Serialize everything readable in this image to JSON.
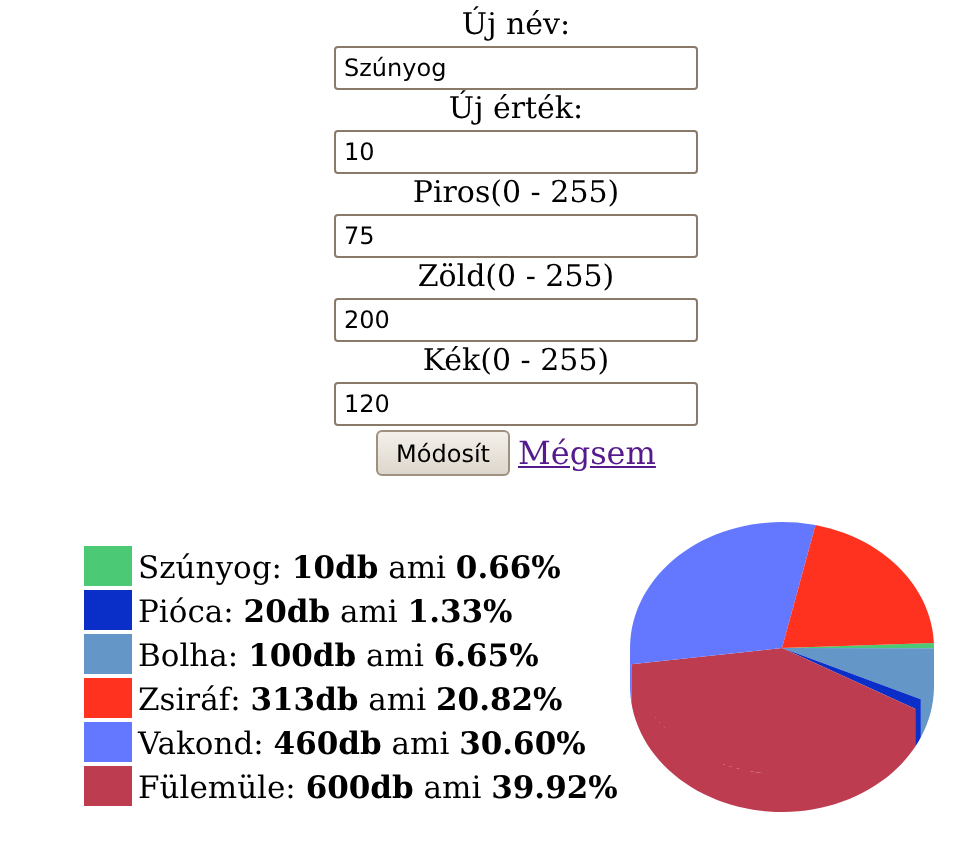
{
  "form": {
    "fields": [
      {
        "label": "Új név:",
        "value": "Szúnyog"
      },
      {
        "label": "Új érték:",
        "value": "10"
      },
      {
        "label": "Piros(0 - 255)",
        "value": "75"
      },
      {
        "label": "Zöld(0 - 255)",
        "value": "200"
      },
      {
        "label": "Kék(0 - 255)",
        "value": "120"
      }
    ],
    "submit": "Módosít",
    "cancel": "Mégsem"
  },
  "legend": [
    {
      "text": "Szúnyog: **10db** ami **0.66%**",
      "color": "#4bc974"
    },
    {
      "text": "Pióca: **20db** ami **1.33%**",
      "color": "#0a2ec8"
    },
    {
      "text": "Bolha: **100db** ami **6.65%**",
      "color": "#6496c8"
    },
    {
      "text": "Zsiráf: **313db** ami **20.82%**",
      "color": "#ff3220"
    },
    {
      "text": "Vakond: **460db** ami **30.60%**",
      "color": "#6478ff"
    },
    {
      "text": "Fülemüle: **600db** ami **39.92%**",
      "color": "#be3c50"
    }
  ]
}
